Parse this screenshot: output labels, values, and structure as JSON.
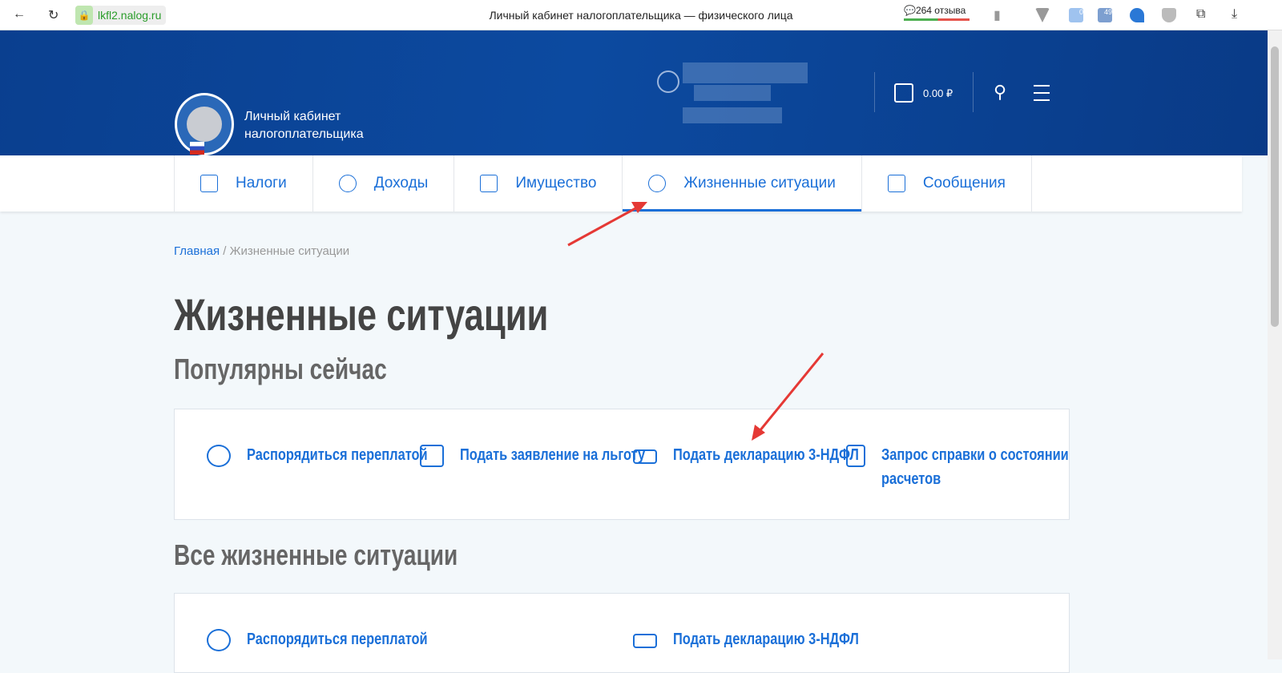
{
  "browser": {
    "url": "lkfl2.nalog.ru",
    "title": "Личный кабинет налогоплательщика — физического лица",
    "reviews": "264 отзыва",
    "ext_badges": [
      "0",
      "49"
    ]
  },
  "header": {
    "brand_line1": "Личный кабинет",
    "brand_line2": "налогоплательщика",
    "balance": "0.00 ₽"
  },
  "nav": [
    {
      "label": "Налоги"
    },
    {
      "label": "Доходы"
    },
    {
      "label": "Имущество"
    },
    {
      "label": "Жизненные ситуации",
      "active": true
    },
    {
      "label": "Сообщения"
    }
  ],
  "breadcrumb": {
    "home": "Главная",
    "sep": " / ",
    "current": "Жизненные ситуации"
  },
  "page_title": "Жизненные ситуации",
  "popular": {
    "title": "Популярны сейчас",
    "items": [
      "Распорядиться переплатой",
      "Подать заявление на льготу",
      "Подать декларацию 3-НДФЛ",
      "Запрос справки о состоянии расчетов"
    ]
  },
  "all": {
    "title": "Все жизненные ситуации",
    "items": [
      "Распорядиться переплатой",
      "Подать декларацию 3-НДФЛ"
    ]
  },
  "colors": {
    "accent": "#1a6fd8",
    "header": "#0c4aa0",
    "arrow": "#e53935"
  }
}
